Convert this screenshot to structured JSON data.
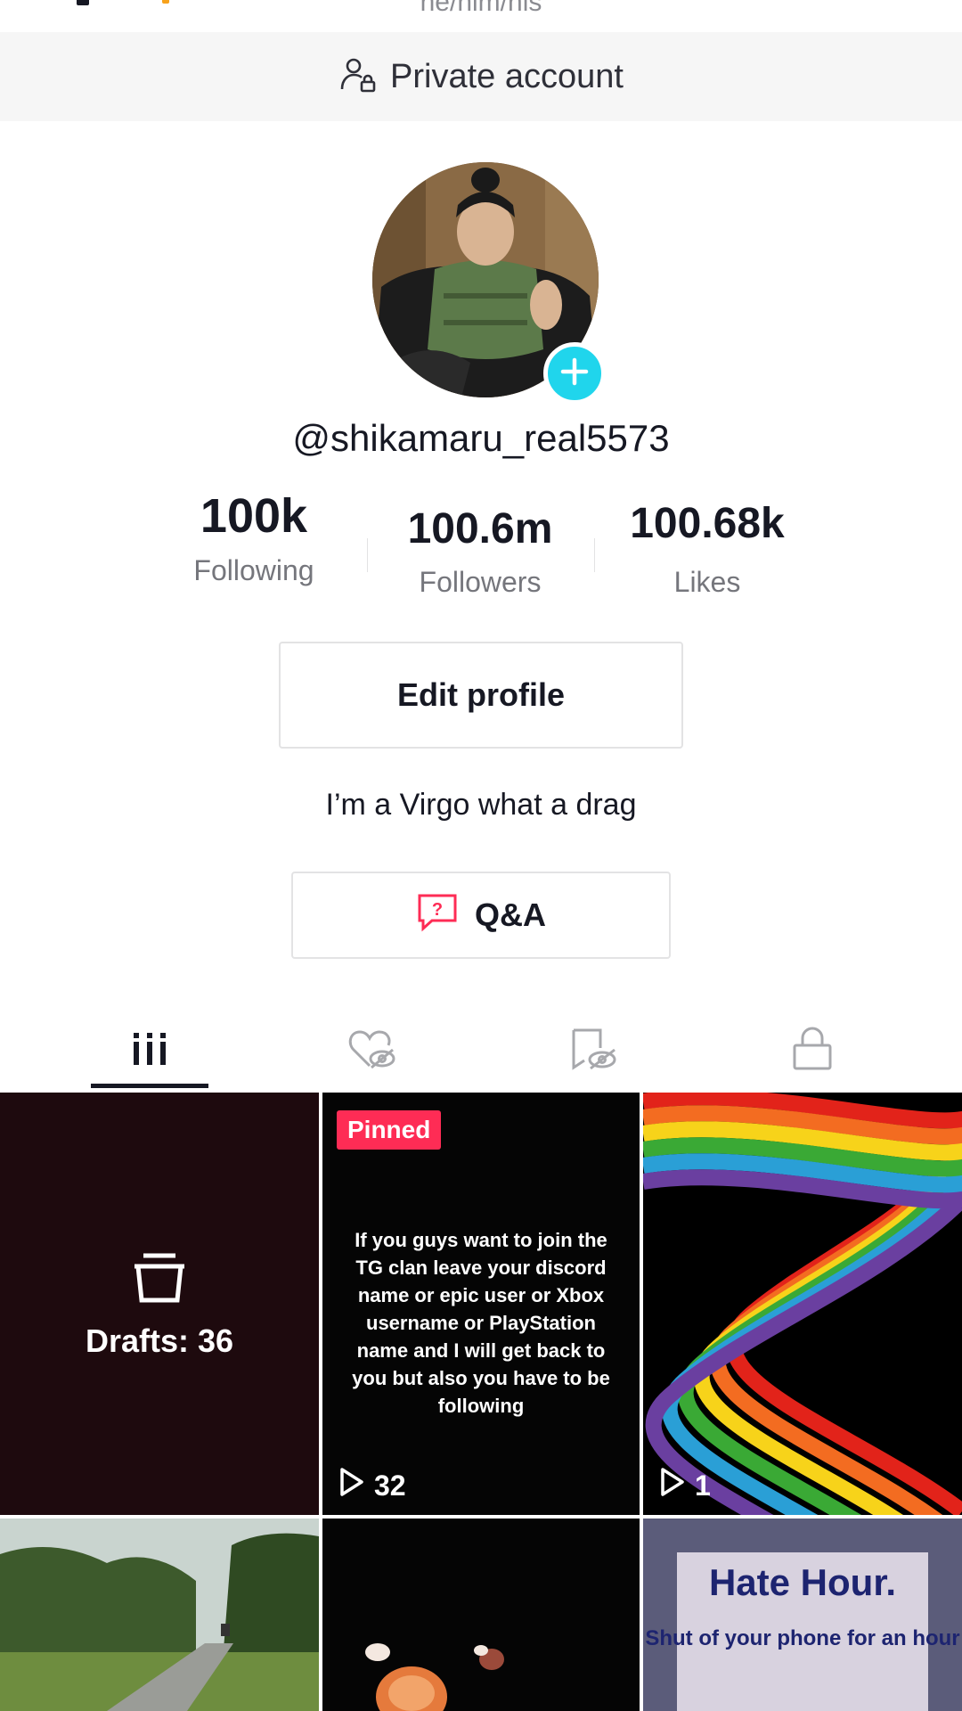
{
  "header": {
    "pronouns": "he/him/his"
  },
  "private_bar": {
    "label": "Private account",
    "icon": "person-lock-icon"
  },
  "profile": {
    "username": "@shikamaru_real5573",
    "avatar": "shikamaru-avatar",
    "add_icon": "plus-icon",
    "bio": "I’m a Virgo what a drag"
  },
  "stats": {
    "following": {
      "value": "100k",
      "label": "Following"
    },
    "followers": {
      "value": "100.6m",
      "label": "Followers"
    },
    "likes": {
      "value": "100.68k",
      "label": "Likes"
    }
  },
  "buttons": {
    "edit_profile": "Edit profile",
    "qa": "Q&A"
  },
  "tabs": [
    {
      "name": "videos",
      "icon": "grid-bars-icon",
      "active": true
    },
    {
      "name": "liked",
      "icon": "heart-hidden-icon",
      "active": false
    },
    {
      "name": "favorites",
      "icon": "bookmark-hidden-icon",
      "active": false
    },
    {
      "name": "private",
      "icon": "lock-icon",
      "active": false
    }
  ],
  "grid": {
    "drafts_label": "Drafts: 36",
    "pinned_badge": "Pinned",
    "pinned_text": "If you guys want to join the TG clan leave your discord name or epic user or Xbox username or PlayStation name and I will get back to you but also you have to be following",
    "pinned_plays": "32",
    "rainbow_plays": "1",
    "hate_title": "Hate Hour.",
    "hate_sub": "Shut of your phone for an hour"
  },
  "colors": {
    "accent_pink": "#fe2c55",
    "accent_cyan": "#20d5ec",
    "text_primary": "#161823",
    "text_secondary": "#75767c"
  }
}
